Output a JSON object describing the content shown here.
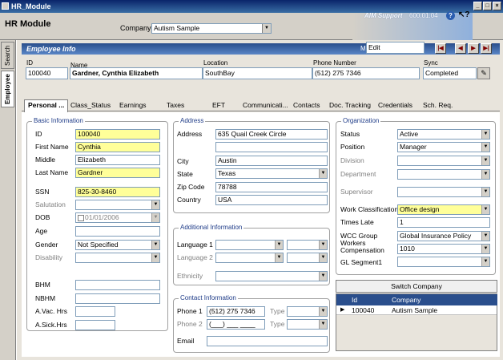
{
  "window": {
    "title": "HR_Module",
    "buttons": [
      "_",
      "□",
      "×"
    ]
  },
  "header": {
    "title": "HR Module",
    "company_label": "Company",
    "company_value": "Autism Sample",
    "aim": "AIM Support",
    "version": "600.01.04"
  },
  "side_tabs": [
    "Search",
    "Employee"
  ],
  "employee_info": {
    "title": "Employee Info",
    "mode_label": "Mode",
    "mode_value": "Edit",
    "nav": [
      "|◀",
      "◀",
      "▶",
      "▶|"
    ],
    "labels": {
      "id": "ID",
      "name": "Name",
      "location": "Location",
      "phone": "Phone Number",
      "sync": "Sync"
    },
    "values": {
      "id": "100040",
      "name": "Gardner, Cynthia Elizabeth",
      "location": "SouthBay",
      "phone": "(512) 275 7346",
      "sync": "Completed"
    }
  },
  "tabs": [
    "Personal ...",
    "Class_Status",
    "Earnings",
    "Taxes",
    "EFT",
    "Communicati...",
    "Contacts",
    "Doc. Tracking",
    "Credentials",
    "Sch. Req."
  ],
  "basic": {
    "legend": "Basic Information",
    "id_label": "ID",
    "id": "100040",
    "first_label": "First Name",
    "first": "Cynthia",
    "middle_label": "Middle",
    "middle": "Elizabeth",
    "last_label": "Last Name",
    "last": "Gardner",
    "ssn_label": "SSN",
    "ssn": "825-30-8460",
    "salutation_label": "Salutation",
    "dob_label": "DOB",
    "dob": "01/01/2006",
    "age_label": "Age",
    "gender_label": "Gender",
    "gender": "Not Specified",
    "disability_label": "Disability",
    "bhm_label": "BHM",
    "nbhm_label": "NBHM",
    "avac_label": "A.Vac. Hrs",
    "asick_label": "A.Sick.Hrs"
  },
  "address": {
    "legend": "Address",
    "address_label": "Address",
    "address": "635 Quail Creek Circle",
    "city_label": "City",
    "city": "Austin",
    "state_label": "State",
    "state": "Texas",
    "zip_label": "Zip Code",
    "zip": "78788",
    "country_label": "Country",
    "country": "USA"
  },
  "additional": {
    "legend": "Additional Information",
    "lang1_label": "Language 1",
    "lang2_label": "Language 2",
    "ethnicity_label": "Ethnicity"
  },
  "contact": {
    "legend": "Contact Information",
    "phone1_label": "Phone 1",
    "phone1": "(512) 275 7346",
    "phone2_label": "Phone 2",
    "phone2": "(___) ___ ____",
    "type_label": "Type",
    "email_label": "Email"
  },
  "organization": {
    "legend": "Organization",
    "status_label": "Status",
    "status": "Active",
    "position_label": "Position",
    "position": "Manager",
    "division_label": "Division",
    "department_label": "Department",
    "supervisor_label": "Supervisor",
    "workclass_label": "Work Classifications",
    "workclass": "Office design",
    "timeslate_label": "Times Late",
    "timeslate": "1",
    "wccgroup_label": "WCC Group",
    "wccgroup": "Global Insurance Policy",
    "workerscomp_label": "Workers Compensation",
    "workerscomp": "1010",
    "glseg_label": "GL Segment1"
  },
  "switch_company": {
    "button": "Switch Company",
    "columns": [
      "Id",
      "Company"
    ],
    "rows": [
      {
        "id": "100040",
        "company": "Autism Sample"
      }
    ]
  }
}
